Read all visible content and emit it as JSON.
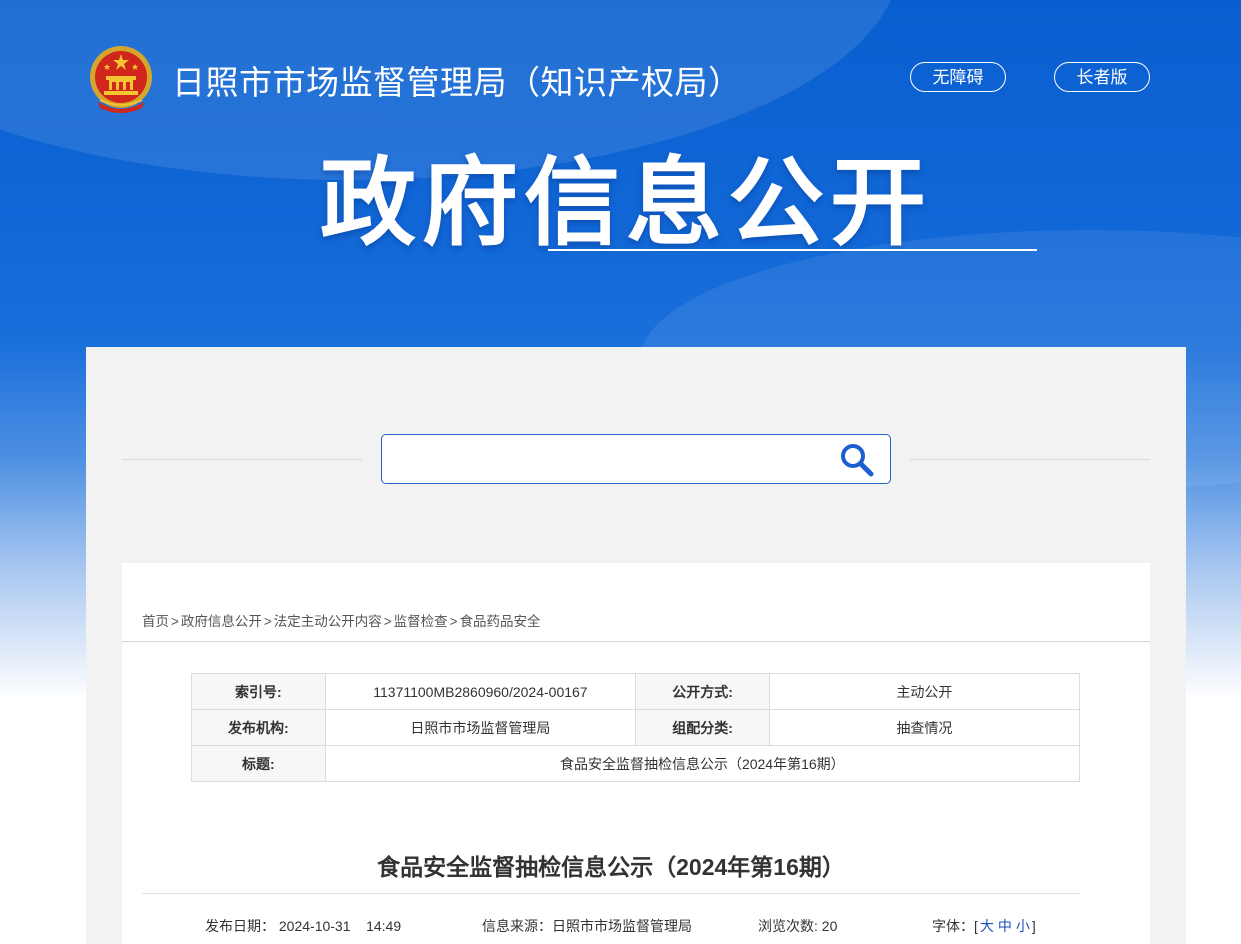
{
  "header": {
    "site_title": "日照市市场监督管理局（知识产权局）",
    "accessibility_label": "无障碍",
    "elderly_label": "长者版",
    "section_title": "政府信息公开"
  },
  "search": {
    "placeholder": ""
  },
  "breadcrumb": {
    "items": [
      "首页",
      "政府信息公开",
      "法定主动公开内容",
      "监督检查",
      "食品药品安全"
    ],
    "separator": ">"
  },
  "meta_table": {
    "index_label": "索引号:",
    "index_value": "11371100MB2860960/2024-00167",
    "open_mode_label": "公开方式:",
    "open_mode_value": "主动公开",
    "publisher_label": "发布机构:",
    "publisher_value": "日照市市场监督管理局",
    "category_label": "组配分类:",
    "category_value": "抽查情况",
    "title_label": "标题:",
    "title_value": "食品安全监督抽检信息公示（2024年第16期）"
  },
  "article": {
    "title": "食品安全监督抽检信息公示（2024年第16期）",
    "publish_date_label": "发布日期：",
    "publish_date": "2024-10-31",
    "publish_time": "14:49",
    "source_label": "信息来源：",
    "source": "日照市市场监督管理局",
    "views_label": "浏览次数:",
    "views": "20",
    "font_label": "字体：",
    "font_bracket_open": "[",
    "font_large": "大",
    "font_medium": "中",
    "font_small": "小",
    "font_bracket_close": "]"
  },
  "colors": {
    "banner_blue": "#0a5fd0",
    "search_border": "#2a63c9",
    "font_size_link": "#1a4fc0"
  }
}
